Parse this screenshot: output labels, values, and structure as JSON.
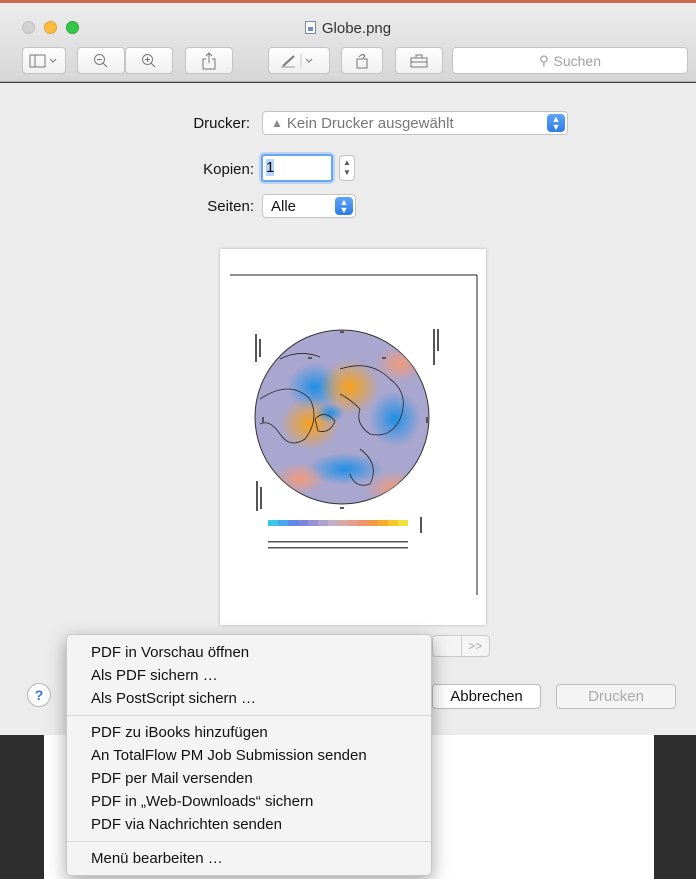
{
  "window": {
    "title": "Globe.png"
  },
  "toolbar": {
    "search_placeholder": "Suchen"
  },
  "print_dialog": {
    "printer_label": "Drucker:",
    "printer_value": "Kein Drucker ausgewählt",
    "copies_label": "Kopien:",
    "copies_value": "1",
    "pages_label": "Seiten:",
    "pages_value": "Alle",
    "nav_next": ">>",
    "cancel_label": "Abbrechen",
    "print_label": "Drucken",
    "help_label": "?"
  },
  "pdf_menu": {
    "group1": [
      "PDF in Vorschau öffnen",
      "Als PDF sichern …",
      "Als PostScript sichern …"
    ],
    "group2": [
      "PDF zu iBooks hinzufügen",
      "An TotalFlow PM Job Submission senden",
      "PDF per Mail versenden",
      "PDF in „Web-Downloads“ sichern",
      "PDF via Nachrichten senden"
    ],
    "group3": [
      "Menü bearbeiten …"
    ]
  },
  "colors": {
    "accent_blue": "#2d7de8",
    "traffic_min": "#fdbc40",
    "traffic_max": "#34c84a"
  }
}
